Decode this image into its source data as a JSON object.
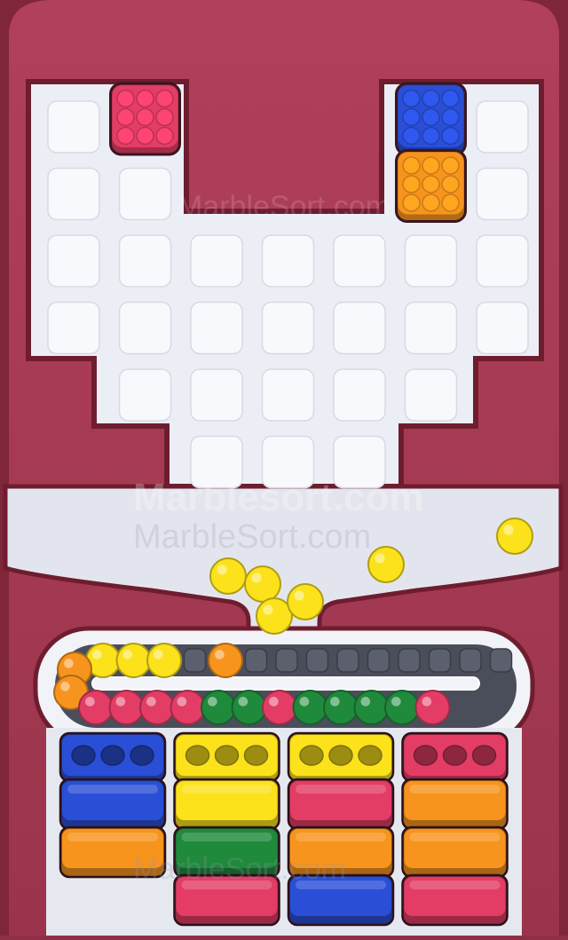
{
  "game": {
    "watermarks": [
      "MarbleSort.com",
      "Marblesort.com",
      "MarbleSort.com",
      "MarbleSort.com"
    ],
    "colors": {
      "red": "#e33d66",
      "blue": "#2a4fd6",
      "orange": "#f7941d",
      "yellow": "#fce21b",
      "green": "#1f8a3c",
      "board_frame": "#a63a52",
      "board_floor": "#eceef5",
      "tile": "#f8f9fd"
    },
    "board": {
      "rows": [
        [
          "tile",
          "block-red",
          null,
          null,
          null,
          "block-blue",
          "tile"
        ],
        [
          "tile",
          "tile",
          null,
          null,
          null,
          "block-orange",
          "tile"
        ],
        [
          "tile",
          "tile",
          "tile",
          "tile",
          "tile",
          "tile",
          "tile"
        ],
        [
          "tile",
          "tile",
          "tile",
          "tile",
          "tile",
          "tile",
          "tile"
        ],
        [
          null,
          "tile",
          "tile",
          "tile",
          "tile",
          "tile",
          null
        ],
        [
          null,
          null,
          "tile",
          "tile",
          "tile",
          null,
          null
        ]
      ]
    },
    "falling_marbles": [
      "yellow",
      "yellow",
      "yellow",
      "yellow",
      "yellow",
      "yellow"
    ],
    "conveyor": {
      "top_lane": [
        "yellow",
        "yellow",
        "yellow",
        "empty",
        "orange",
        "empty",
        "empty",
        "empty",
        "empty",
        "empty",
        "empty",
        "empty",
        "empty",
        "empty"
      ],
      "left_turn": [
        "orange",
        "orange"
      ],
      "bottom_lane": [
        "red",
        "red",
        "red",
        "red",
        "green",
        "green",
        "red",
        "green",
        "green",
        "green",
        "green",
        "red"
      ]
    },
    "sorting_columns": [
      {
        "top_box": "blue",
        "stack": [
          "blue",
          "orange"
        ]
      },
      {
        "top_box": "yellow",
        "stack": [
          "yellow",
          "green",
          "red"
        ]
      },
      {
        "top_box": "yellow",
        "stack": [
          "red",
          "orange",
          "blue"
        ]
      },
      {
        "top_box": "red",
        "stack": [
          "orange",
          "orange",
          "red"
        ]
      }
    ]
  }
}
